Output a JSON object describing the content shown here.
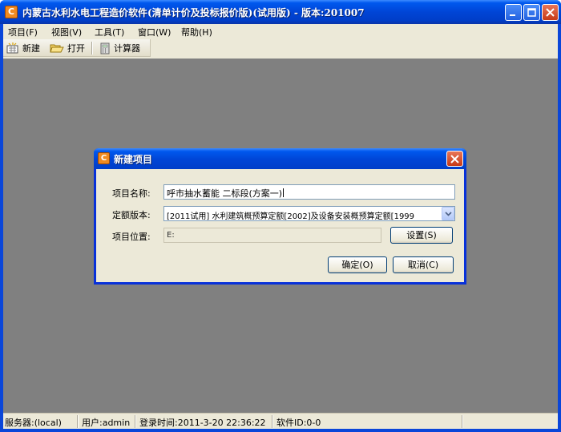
{
  "app": {
    "title": "内蒙古水利水电工程造价软件(清单计价及投标报价版)(试用版) - 版本:201007",
    "icon_letter": "C"
  },
  "menu": [
    {
      "label": "项目(F)"
    },
    {
      "label": "视图(V)"
    },
    {
      "label": "工具(T)"
    },
    {
      "label": "窗口(W)"
    },
    {
      "label": "帮助(H)"
    }
  ],
  "toolbar": {
    "new_label": "新建",
    "open_label": "打开",
    "calculator_label": "计算器"
  },
  "dialog": {
    "title": "新建项目",
    "name_label": "项目名称:",
    "name_value": "呼市抽水蓄能 二标段(方案一)",
    "quota_label": "定额版本:",
    "quota_value": "[2011试用] 水利建筑概预算定额[2002]及设备安装概预算定额[1999",
    "location_label": "项目位置:",
    "location_value": "E:",
    "settings_label": "设置(S)",
    "ok_label": "确定(O)",
    "cancel_label": "取消(C)"
  },
  "status": {
    "server": "服务器:(local)",
    "user": "用户:admin",
    "login_time": "登录时间:2011-3-20 22:36:22",
    "software_id": "软件ID:0-0"
  },
  "colors": {
    "title_blue": "#0054e3",
    "workspace_gray": "#808080",
    "face": "#ece9d8",
    "close_red": "#d9532c"
  }
}
